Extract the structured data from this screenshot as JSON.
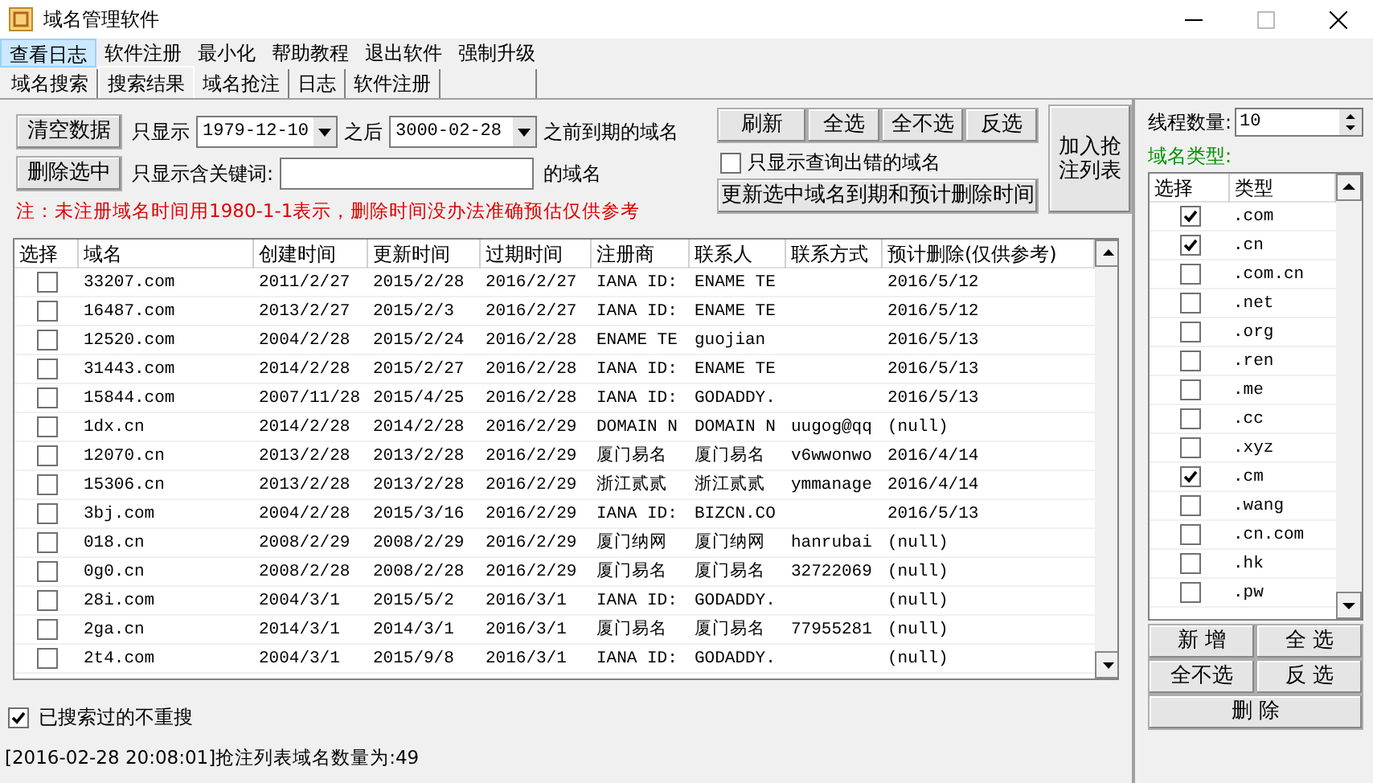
{
  "window": {
    "title": "域名管理软件"
  },
  "menu": [
    {
      "label": "查看日志",
      "selected": true
    },
    {
      "label": "软件注册",
      "selected": false
    },
    {
      "label": "最小化",
      "selected": false
    },
    {
      "label": "帮助教程",
      "selected": false
    },
    {
      "label": "退出软件",
      "selected": false
    },
    {
      "label": "强制升级",
      "selected": false
    }
  ],
  "tabs": [
    {
      "label": "域名搜索",
      "selected": false
    },
    {
      "label": "搜索结果",
      "selected": true
    },
    {
      "label": "域名抢注",
      "selected": false
    },
    {
      "label": "日志",
      "selected": false
    },
    {
      "label": "软件注册",
      "selected": false
    }
  ],
  "filters": {
    "clear_button": "清空数据",
    "delete_button": "删除选中",
    "show_label": "只显示",
    "date_from": "1979-12-10",
    "after_label": "之后",
    "date_to": "3000-02-28",
    "before_label": "之前到期的域名",
    "keyword_label": "只显示含关键词:",
    "keyword_suffix": "的域名",
    "note": "注：未注册域名时间用1980-1-1表示，删除时间没办法准确预估仅供参考"
  },
  "actions": {
    "buttons": [
      "刷新",
      "全选",
      "全不选",
      "反选"
    ],
    "errors_only": {
      "label": "只显示查询出错的域名",
      "checked": false
    },
    "update_button": "更新选中域名到期和预计删除时间",
    "add_button": [
      "加入抢",
      "注列表"
    ]
  },
  "table": {
    "select_column": "选择",
    "columns": [
      "域名",
      "创建时间",
      "更新时间",
      "过期时间",
      "注册商",
      "联系人",
      "联系方式",
      "预计删除(仅供参考)"
    ],
    "rows": [
      {
        "checked": false,
        "cells": [
          "33207.com",
          "2011/2/27",
          "2015/2/28",
          "2016/2/27",
          "IANA ID:",
          "ENAME TE",
          "",
          "2016/5/12"
        ]
      },
      {
        "checked": false,
        "cells": [
          "16487.com",
          "2013/2/27",
          "2015/2/3",
          "2016/2/27",
          "IANA ID:",
          "ENAME TE",
          "",
          "2016/5/12"
        ]
      },
      {
        "checked": false,
        "cells": [
          "12520.com",
          "2004/2/28",
          "2015/2/24",
          "2016/2/28",
          "ENAME TE",
          "guojian",
          "",
          "2016/5/13"
        ]
      },
      {
        "checked": false,
        "cells": [
          "31443.com",
          "2014/2/28",
          "2015/2/27",
          "2016/2/28",
          "IANA ID:",
          "ENAME TE",
          "",
          "2016/5/13"
        ]
      },
      {
        "checked": false,
        "cells": [
          "15844.com",
          "2007/11/28",
          "2015/4/25",
          "2016/2/28",
          "IANA ID:",
          "GODADDY.",
          "",
          "2016/5/13"
        ]
      },
      {
        "checked": false,
        "cells": [
          "1dx.cn",
          "2014/2/28",
          "2014/2/28",
          "2016/2/29",
          "DOMAIN N",
          "DOMAIN N",
          "uugog@qq",
          "(null)"
        ]
      },
      {
        "checked": false,
        "cells": [
          "12070.cn",
          "2013/2/28",
          "2013/2/28",
          "2016/2/29",
          "厦门易名",
          "厦门易名",
          "v6wwonwo",
          "2016/4/14"
        ]
      },
      {
        "checked": false,
        "cells": [
          "15306.cn",
          "2013/2/28",
          "2013/2/28",
          "2016/2/29",
          "浙江贰贰",
          "浙江贰贰",
          "ymmanage",
          "2016/4/14"
        ]
      },
      {
        "checked": false,
        "cells": [
          "3bj.com",
          "2004/2/28",
          "2015/3/16",
          "2016/2/29",
          "IANA ID:",
          "BIZCN.CO",
          "",
          "2016/5/13"
        ]
      },
      {
        "checked": false,
        "cells": [
          "018.cn",
          "2008/2/29",
          "2008/2/29",
          "2016/2/29",
          "厦门纳网",
          "厦门纳网",
          "hanrubai",
          "(null)"
        ]
      },
      {
        "checked": false,
        "cells": [
          "0g0.cn",
          "2008/2/28",
          "2008/2/28",
          "2016/2/29",
          "厦门易名",
          "厦门易名",
          "32722069",
          "(null)"
        ]
      },
      {
        "checked": false,
        "cells": [
          "28i.com",
          "2004/3/1",
          "2015/5/2",
          "2016/3/1",
          "IANA ID:",
          "GODADDY.",
          "",
          "(null)"
        ]
      },
      {
        "checked": false,
        "cells": [
          "2ga.cn",
          "2014/3/1",
          "2014/3/1",
          "2016/3/1",
          "厦门易名",
          "厦门易名",
          "77955281",
          "(null)"
        ]
      },
      {
        "checked": false,
        "cells": [
          "2t4.com",
          "2004/3/1",
          "2015/9/8",
          "2016/3/1",
          "IANA ID:",
          "GODADDY.",
          "",
          "(null)"
        ]
      }
    ]
  },
  "no_repeat": {
    "label": "已搜索过的不重搜",
    "checked": true
  },
  "status_bar": "[2016-02-28 20:08:01]抢注列表域名数量为:49",
  "side": {
    "threads_label": "线程数量:",
    "threads_value": "10",
    "types_label": "域名类型:",
    "columns": [
      "选择",
      "类型"
    ],
    "types": [
      {
        "name": ".com",
        "checked": true
      },
      {
        "name": ".cn",
        "checked": true
      },
      {
        "name": ".com.cn",
        "checked": false
      },
      {
        "name": ".net",
        "checked": false
      },
      {
        "name": ".org",
        "checked": false
      },
      {
        "name": ".ren",
        "checked": false
      },
      {
        "name": ".me",
        "checked": false
      },
      {
        "name": ".cc",
        "checked": false
      },
      {
        "name": ".xyz",
        "checked": false
      },
      {
        "name": ".cm",
        "checked": true
      },
      {
        "name": ".wang",
        "checked": false
      },
      {
        "name": ".cn.com",
        "checked": false
      },
      {
        "name": ".hk",
        "checked": false
      },
      {
        "name": ".pw",
        "checked": false
      }
    ],
    "buttons": [
      "新 增",
      "全 选",
      "全不选",
      "反 选"
    ],
    "delete_button": "删 除"
  }
}
